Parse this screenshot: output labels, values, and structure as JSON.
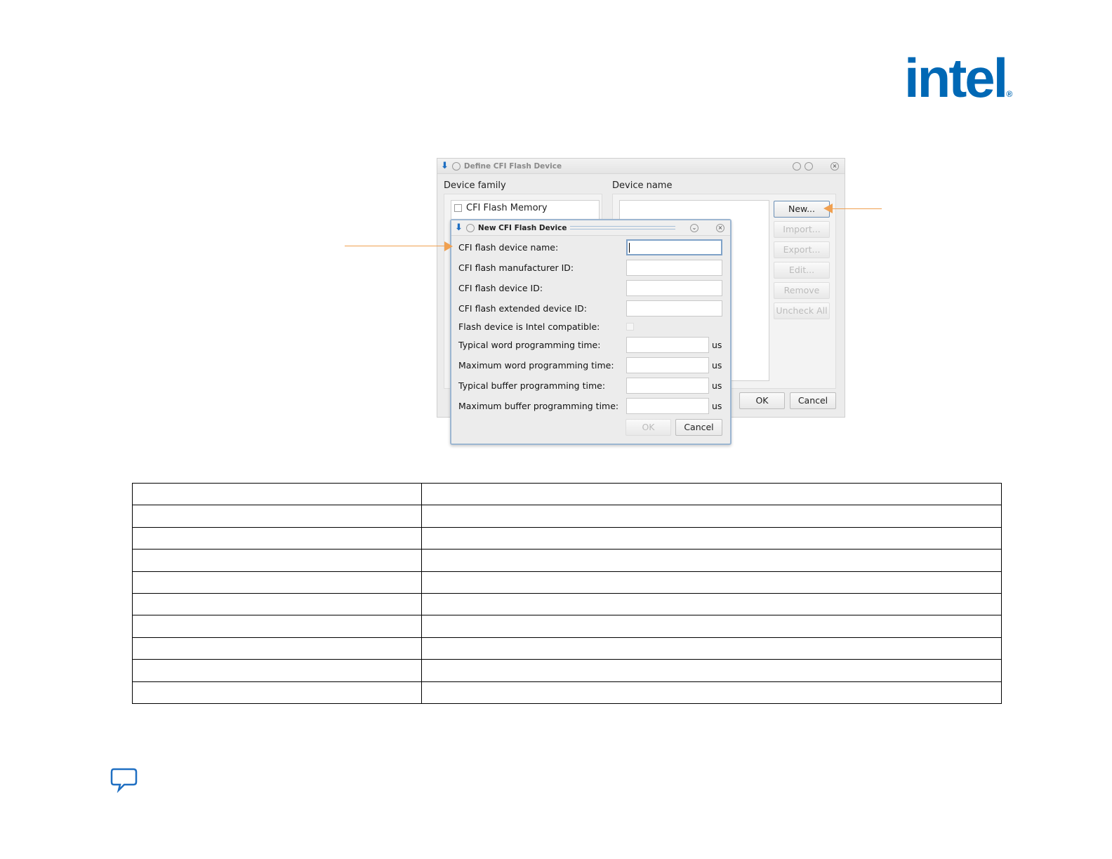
{
  "logo": {
    "text": "intel",
    "mark": "®",
    "color": "#0068b5"
  },
  "outer_dialog": {
    "title": "Define CFI Flash Device",
    "device_family_label": "Device family",
    "device_name_label": "Device name",
    "family_items": [
      "CFI Flash Memory"
    ],
    "buttons": {
      "new": "New...",
      "import": "Import...",
      "export": "Export...",
      "edit": "Edit...",
      "remove": "Remove",
      "uncheck_all": "Uncheck All",
      "ok": "OK",
      "cancel": "Cancel"
    }
  },
  "inner_dialog": {
    "title": "New CFI Flash Device",
    "fields": [
      {
        "label": "CFI flash device name:",
        "value": ""
      },
      {
        "label": "CFI flash manufacturer ID:",
        "value": ""
      },
      {
        "label": "CFI flash device ID:",
        "value": ""
      },
      {
        "label": "CFI flash extended device ID:",
        "value": ""
      }
    ],
    "checkbox_label": "Flash device is Intel compatible:",
    "time_fields": [
      {
        "label": "Typical word programming time:",
        "unit": "us",
        "value": ""
      },
      {
        "label": "Maximum word programming time:",
        "unit": "us",
        "value": ""
      },
      {
        "label": "Typical buffer programming time:",
        "unit": "us",
        "value": ""
      },
      {
        "label": "Maximum buffer programming time:",
        "unit": "us",
        "value": ""
      }
    ],
    "ok": "OK",
    "cancel": "Cancel"
  },
  "accent_color": "#f0a050"
}
